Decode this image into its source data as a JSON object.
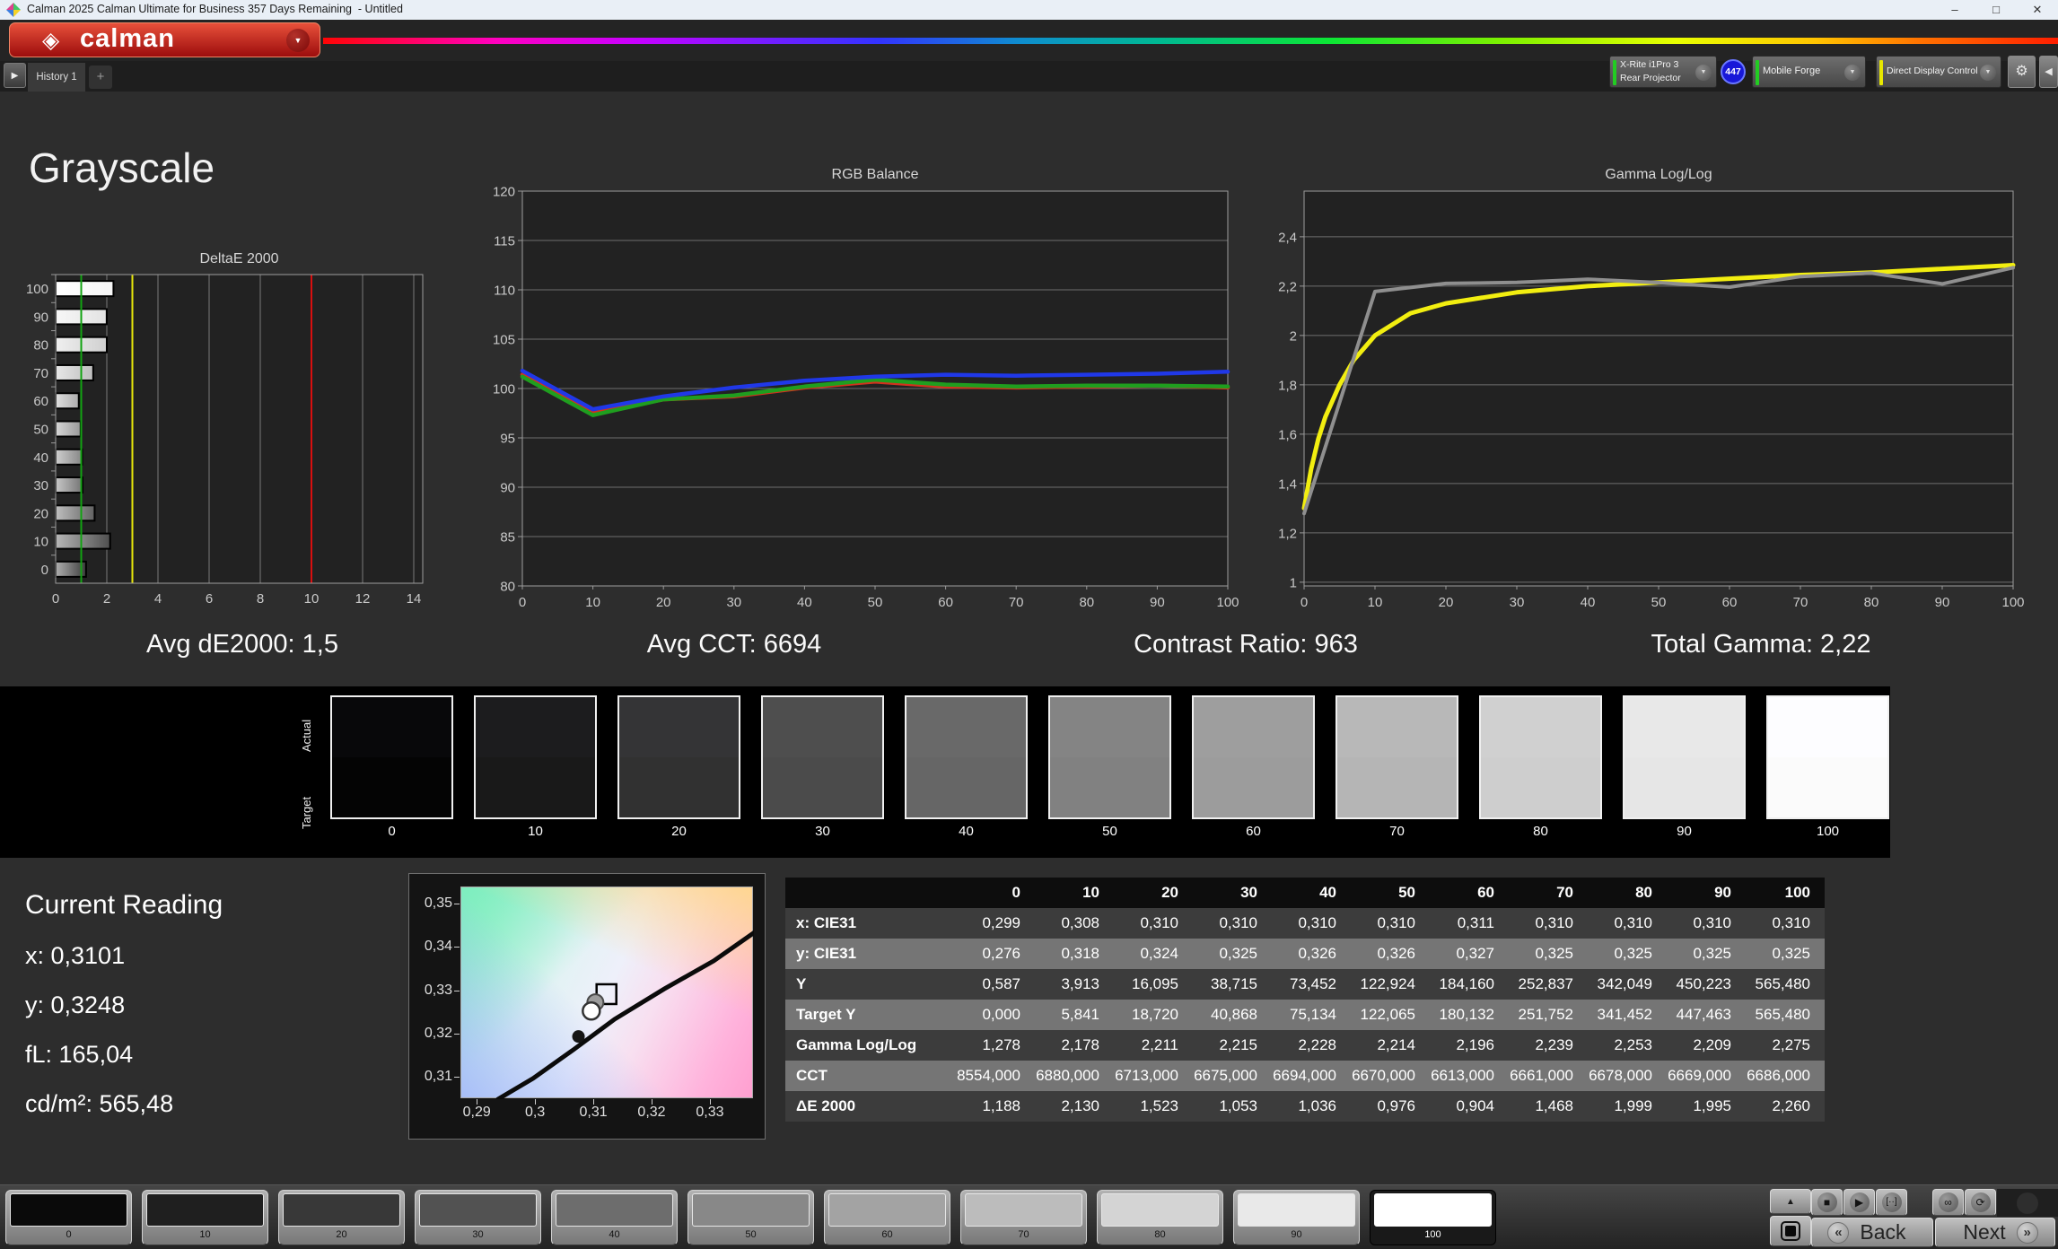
{
  "window": {
    "title": "Calman 2025 Calman Ultimate for Business 357 Days Remaining  - Untitled",
    "minimize": "–",
    "maximize": "□",
    "close": "✕"
  },
  "brand": {
    "diamond": "◈",
    "logo_text": "calman",
    "dropdown": "▼"
  },
  "tabs": {
    "arrow": "▶",
    "history": "History 1",
    "add": "+"
  },
  "meters": {
    "chevron": "▼",
    "meter": {
      "line1": "X-Rite i1Pro 3",
      "line2": "Rear Projector",
      "badge": "447",
      "indicator": "#22cc22"
    },
    "pattern_source": {
      "label": "Mobile Forge",
      "indicator": "#22cc22"
    },
    "display_control": {
      "label": "Direct Display Control",
      "indicator": "#e8e800"
    },
    "gear": "⚙",
    "side_arrow": "◀"
  },
  "page": {
    "title": "Grayscale"
  },
  "summary": {
    "avg_de2000": "Avg dE2000: 1,5",
    "avg_cct": "Avg CCT: 6694",
    "contrast_ratio": "Contrast Ratio: 963",
    "total_gamma": "Total Gamma: 2,22"
  },
  "chart_data": [
    {
      "type": "bar",
      "orientation": "horizontal",
      "title": "DeltaE 2000",
      "categories": [
        100,
        90,
        80,
        70,
        60,
        50,
        40,
        30,
        20,
        10,
        0
      ],
      "values": [
        2.26,
        1.995,
        1.999,
        1.468,
        0.904,
        0.976,
        1.036,
        1.053,
        1.523,
        2.13,
        1.188
      ],
      "xlim": [
        0,
        14
      ],
      "xticks": [
        0,
        2,
        4,
        6,
        8,
        10,
        12,
        14
      ],
      "grid": "vertical",
      "reference_lines": [
        {
          "value": 1,
          "color": "#12a312"
        },
        {
          "value": 3,
          "color": "#e6e60a"
        },
        {
          "value": 10,
          "color": "#d90f0f"
        }
      ]
    },
    {
      "type": "line",
      "title": "RGB Balance",
      "x": [
        0,
        10,
        20,
        30,
        40,
        50,
        60,
        70,
        80,
        90,
        100
      ],
      "xlim": [
        0,
        100
      ],
      "xticks": [
        0,
        10,
        20,
        30,
        40,
        50,
        60,
        70,
        80,
        90,
        100
      ],
      "ylim": [
        80,
        120
      ],
      "ydraw": [
        80,
        120
      ],
      "yticks": [
        80,
        85,
        90,
        95,
        100,
        105,
        110,
        115,
        120
      ],
      "ytick_labels": [
        "80",
        "85",
        "90",
        "95",
        "100",
        "105",
        "110",
        "115",
        "120"
      ],
      "grid": "horizontal",
      "legend": "none",
      "series": [
        {
          "name": "Red",
          "color": "#d2321e",
          "width": 4.5,
          "values": [
            101.4,
            97.6,
            98.9,
            99.2,
            100.1,
            100.7,
            100.2,
            100.1,
            100.2,
            100.3,
            100.1
          ]
        },
        {
          "name": "Green",
          "color": "#1f9e1f",
          "width": 4.5,
          "values": [
            101.2,
            97.3,
            98.9,
            99.3,
            100.2,
            100.9,
            100.4,
            100.2,
            100.3,
            100.3,
            100.2
          ]
        },
        {
          "name": "Blue",
          "color": "#2038e8",
          "width": 4.5,
          "values": [
            101.8,
            97.9,
            99.2,
            100.1,
            100.8,
            101.2,
            101.4,
            101.3,
            101.4,
            101.5,
            101.7
          ]
        }
      ]
    },
    {
      "type": "line",
      "title": "Gamma Log/Log",
      "x": [
        0,
        10,
        20,
        30,
        40,
        50,
        60,
        70,
        80,
        90,
        100
      ],
      "xlim": [
        0,
        100
      ],
      "xticks": [
        0,
        10,
        20,
        30,
        40,
        50,
        60,
        70,
        80,
        90,
        100
      ],
      "ylim": [
        1,
        2.4
      ],
      "ydraw": [
        0.985,
        2.585
      ],
      "yticks": [
        1,
        1.2,
        1.4,
        1.6,
        1.8,
        2,
        2.2,
        2.4
      ],
      "ytick_labels": [
        "1",
        "1,2",
        "1,4",
        "1,6",
        "1,8",
        "2",
        "2,2",
        "2,4"
      ],
      "grid": "horizontal",
      "legend": "none",
      "series": [
        {
          "name": "Target",
          "color": "#f2ee10",
          "width": 5,
          "x": [
            0,
            1,
            2,
            3,
            5,
            7,
            10,
            15,
            20,
            30,
            40,
            50,
            60,
            70,
            80,
            90,
            100
          ],
          "values": [
            1.3,
            1.46,
            1.58,
            1.67,
            1.8,
            1.9,
            2.0,
            2.09,
            2.13,
            2.175,
            2.2,
            2.215,
            2.23,
            2.245,
            2.255,
            2.27,
            2.285
          ]
        },
        {
          "name": "Measured",
          "color": "#8f8f8f",
          "width": 4,
          "values": [
            1.278,
            2.178,
            2.211,
            2.215,
            2.228,
            2.214,
            2.196,
            2.239,
            2.253,
            2.209,
            2.275
          ]
        }
      ]
    }
  ],
  "swatch_strip": {
    "actual_label": "Actual",
    "target_label": "Target",
    "levels": [
      "0",
      "10",
      "20",
      "30",
      "40",
      "50",
      "60",
      "70",
      "80",
      "90",
      "100"
    ],
    "actual_colors": [
      "#08080a",
      "#1c1c1e",
      "#343436",
      "#4e4e4e",
      "#696969",
      "#848484",
      "#9e9e9e",
      "#b8b8b8",
      "#d0d0d0",
      "#e8e8e8",
      "#fdfdff"
    ],
    "target_colors": [
      "#040404",
      "#191919",
      "#313131",
      "#4b4b4b",
      "#666666",
      "#818181",
      "#9c9c9c",
      "#b5b5b5",
      "#cecece",
      "#e6e6e6",
      "#fbfbfb"
    ]
  },
  "current_reading": {
    "title": "Current Reading",
    "x": "x: 0,3101",
    "y": "y: 0,3248",
    "fl": "fL: 165,04",
    "cdm2": "cd/m²: 565,48"
  },
  "cie": {
    "yticks": [
      "0,35",
      "0,34",
      "0,33",
      "0,32",
      "0,31"
    ],
    "xticks": [
      "0,29",
      "0,3",
      "0,31",
      "0,32",
      "0,33"
    ],
    "x_range": [
      0.2872,
      0.3374
    ],
    "y_range": [
      0.305,
      0.354
    ],
    "locus": [
      [
        0.2935,
        0.305
      ],
      [
        0.2995,
        0.3098
      ],
      [
        0.3065,
        0.3165
      ],
      [
        0.3135,
        0.3235
      ],
      [
        0.322,
        0.3305
      ],
      [
        0.3305,
        0.337
      ],
      [
        0.3374,
        0.3435
      ]
    ],
    "markers": {
      "target_square": [
        0.3121,
        0.3293
      ],
      "gray_point": [
        0.3102,
        0.3274
      ],
      "current_point": [
        0.3095,
        0.3254
      ],
      "black_point": [
        0.3073,
        0.3195
      ]
    }
  },
  "table": {
    "columns": [
      "0",
      "10",
      "20",
      "30",
      "40",
      "50",
      "60",
      "70",
      "80",
      "90",
      "100"
    ],
    "rows": [
      {
        "label": "x: CIE31",
        "values": [
          "0,299",
          "0,308",
          "0,310",
          "0,310",
          "0,310",
          "0,310",
          "0,311",
          "0,310",
          "0,310",
          "0,310",
          "0,310"
        ]
      },
      {
        "label": "y: CIE31",
        "values": [
          "0,276",
          "0,318",
          "0,324",
          "0,325",
          "0,326",
          "0,326",
          "0,327",
          "0,325",
          "0,325",
          "0,325",
          "0,325"
        ]
      },
      {
        "label": "Y",
        "values": [
          "0,587",
          "3,913",
          "16,095",
          "38,715",
          "73,452",
          "122,924",
          "184,160",
          "252,837",
          "342,049",
          "450,223",
          "565,480"
        ]
      },
      {
        "label": "Target Y",
        "values": [
          "0,000",
          "5,841",
          "18,720",
          "40,868",
          "75,134",
          "122,065",
          "180,132",
          "251,752",
          "341,452",
          "447,463",
          "565,480"
        ]
      },
      {
        "label": "Gamma Log/Log",
        "values": [
          "1,278",
          "2,178",
          "2,211",
          "2,215",
          "2,228",
          "2,214",
          "2,196",
          "2,239",
          "2,253",
          "2,209",
          "2,275"
        ]
      },
      {
        "label": "CCT",
        "values": [
          "8554,000",
          "6880,000",
          "6713,000",
          "6675,000",
          "6694,000",
          "6670,000",
          "6613,000",
          "6661,000",
          "6678,000",
          "6669,000",
          "6686,000"
        ]
      },
      {
        "label": "ΔE 2000",
        "values": [
          "1,188",
          "2,130",
          "1,523",
          "1,053",
          "1,036",
          "0,976",
          "0,904",
          "1,468",
          "1,999",
          "1,995",
          "2,260"
        ]
      }
    ]
  },
  "bottom_bar": {
    "patches": {
      "levels": [
        "0",
        "10",
        "20",
        "30",
        "40",
        "50",
        "60",
        "70",
        "80",
        "90",
        "100"
      ],
      "colors": [
        "#0a0a0a",
        "#1f1f1f",
        "#383838",
        "#525252",
        "#6d6d6d",
        "#888888",
        "#a3a3a3",
        "#bcbcbc",
        "#d4d4d4",
        "#e9e9e9",
        "#ffffff"
      ],
      "selected": "100"
    },
    "transport": {
      "up": "▲",
      "stop": "■",
      "play": "▶",
      "pattern": "[··]",
      "loop": "∞",
      "refresh": "⟳"
    },
    "back_chev": "«",
    "back_label": "Back",
    "next_label": "Next",
    "next_chev": "»"
  }
}
